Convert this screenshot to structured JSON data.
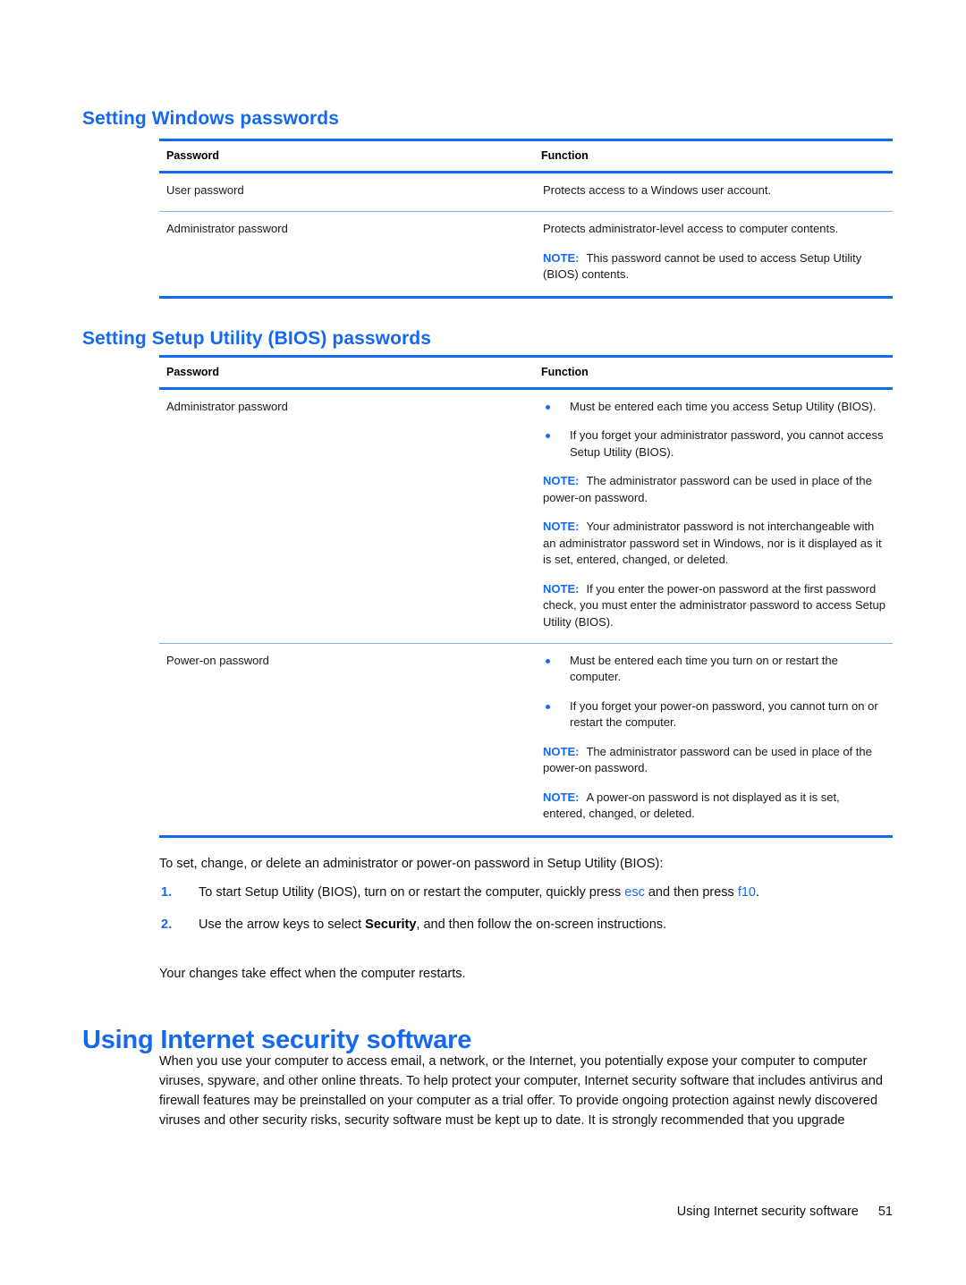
{
  "page": {
    "footer_title": "Using Internet security software",
    "footer_page_number": "51",
    "accent_color": "#1569f0",
    "text_color": "#111111"
  },
  "section_windows": {
    "heading": "Setting Windows passwords",
    "table": {
      "headers": [
        "Password",
        "Function"
      ],
      "rows": [
        {
          "password": "User password",
          "function_text": "Protects access to a Windows user account."
        },
        {
          "password": "Administrator password",
          "function_text": "Protects administrator-level access to computer contents.",
          "notes": [
            {
              "label": "NOTE:",
              "text": "This password cannot be used to access Setup Utility (BIOS) contents."
            }
          ]
        }
      ]
    }
  },
  "section_bios": {
    "heading": "Setting Setup Utility (BIOS) passwords",
    "table": {
      "headers": [
        "Password",
        "Function"
      ],
      "rows": [
        {
          "password": "Administrator password",
          "bullets": [
            "Must be entered each time you access Setup Utility (BIOS).",
            "If you forget your administrator password, you cannot access Setup Utility (BIOS)."
          ],
          "notes": [
            {
              "label": "NOTE:",
              "text": "The administrator password can be used in place of the power-on password."
            },
            {
              "label": "NOTE:",
              "text": "Your administrator password is not interchangeable with an administrator password set in Windows, nor is it displayed as it is set, entered, changed, or deleted."
            },
            {
              "label": "NOTE:",
              "text": "If you enter the power-on password at the first password check, you must enter the administrator password to access Setup Utility (BIOS)."
            }
          ]
        },
        {
          "password": "Power-on password",
          "bullets": [
            "Must be entered each time you turn on or restart the computer.",
            "If you forget your power-on password, you cannot turn on or restart the computer."
          ],
          "notes": [
            {
              "label": "NOTE:",
              "text": "The administrator password can be used in place of the power-on password."
            },
            {
              "label": "NOTE:",
              "text": "A power-on password is not displayed as it is set, entered, changed, or deleted."
            }
          ]
        }
      ]
    },
    "intro": "To set, change, or delete an administrator or power-on password in Setup Utility (BIOS):",
    "steps": [
      {
        "number": "1.",
        "part1": "To start Setup Utility (BIOS), turn on or restart the computer, quickly press ",
        "key1": "esc",
        "part2": " and then press ",
        "key2": "f10",
        "part3": "."
      },
      {
        "number": "2.",
        "part1": "Use the arrow keys to select ",
        "emphasis": "Security",
        "part2": ", and then follow the on-screen instructions.",
        "key1": "",
        "key2": "",
        "part3": ""
      }
    ],
    "closing": "Your changes take effect when the computer restarts."
  },
  "section_internet": {
    "heading": "Using Internet security software",
    "paragraph": "When you use your computer to access email, a network, or the Internet, you potentially expose your computer to computer viruses, spyware, and other online threats. To help protect your computer, Internet security software that includes antivirus and firewall features may be preinstalled on your computer as a trial offer. To provide ongoing protection against newly discovered viruses and other security risks, security software must be kept up to date. It is strongly recommended that you upgrade"
  }
}
